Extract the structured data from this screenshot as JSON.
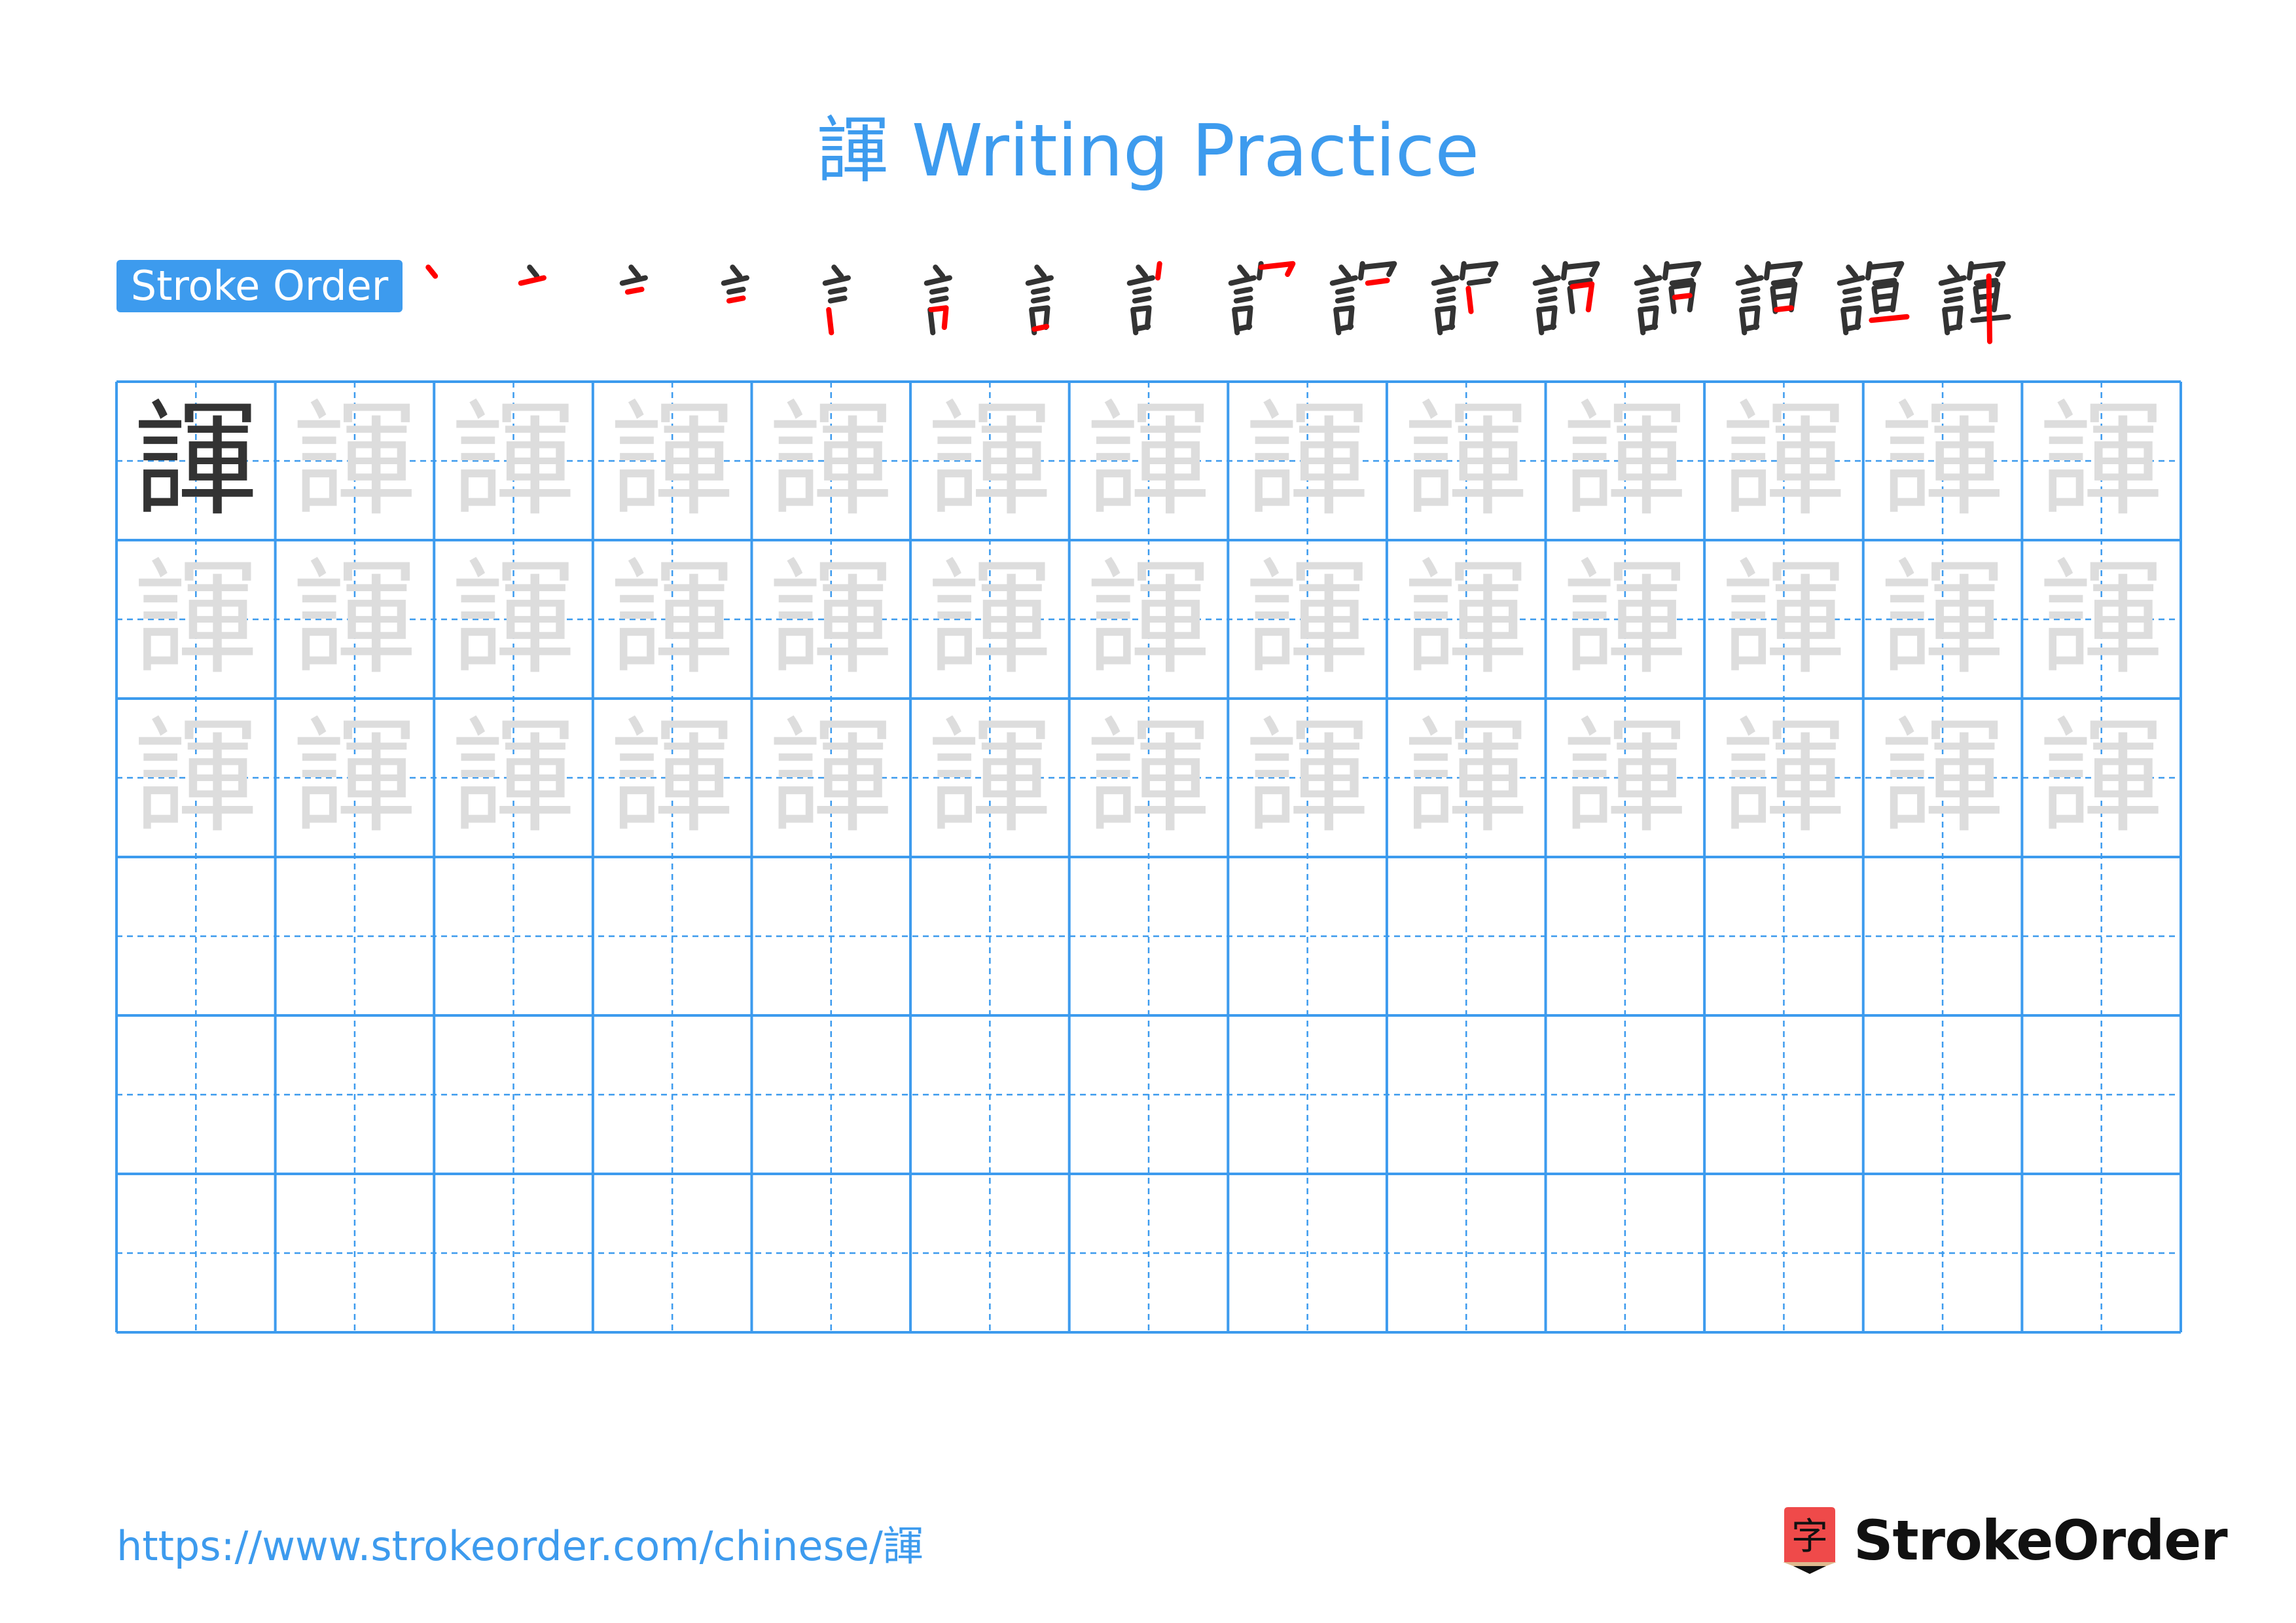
{
  "page": {
    "character": "諢",
    "title": "諢 Writing Practice",
    "stroke_order_label": "Stroke Order",
    "footer_url": "https://www.strokeorder.com/chinese/諢",
    "brand": "StrokeOrder",
    "logo_glyph": "字"
  },
  "colors": {
    "accent": "#3d9bee",
    "model_char": "#333333",
    "trace_char": "#dddddd",
    "current_stroke": "#ff0000",
    "logo_red": "#ef4a4a",
    "logo_wood": "#deb98f"
  },
  "stroke_order": {
    "total_strokes": 16,
    "steps": [
      {
        "step": 1
      },
      {
        "step": 2
      },
      {
        "step": 3
      },
      {
        "step": 4
      },
      {
        "step": 5
      },
      {
        "step": 6
      },
      {
        "step": 7
      },
      {
        "step": 8
      },
      {
        "step": 9
      },
      {
        "step": 10
      },
      {
        "step": 11
      },
      {
        "step": 12
      },
      {
        "step": 13
      },
      {
        "step": 14
      },
      {
        "step": 15
      },
      {
        "step": 16
      }
    ]
  },
  "practice_grid": {
    "columns": 13,
    "rows": 6,
    "model_cells": 1,
    "trace_rows": 3,
    "empty_rows": 3
  }
}
